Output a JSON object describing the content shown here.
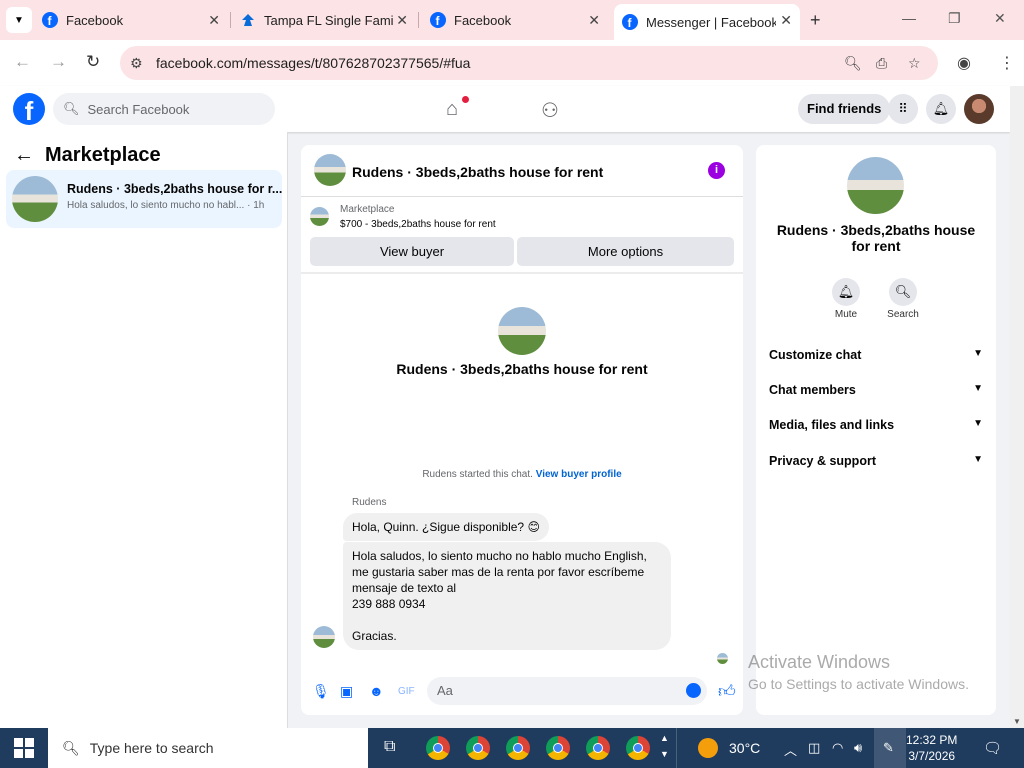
{
  "browser": {
    "tabs": [
      {
        "title": "Facebook",
        "icon": "facebook-icon",
        "active": false
      },
      {
        "title": "Tampa FL Single Family",
        "icon": "zillow-icon",
        "active": false
      },
      {
        "title": "Facebook",
        "icon": "facebook-icon",
        "active": false
      },
      {
        "title": "Messenger | Facebook",
        "icon": "facebook-icon",
        "active": true
      }
    ],
    "new_tab": "+",
    "url": "facebook.com/messages/t/807628702377565/#fua"
  },
  "fb": {
    "logo": "f",
    "search_placeholder": "Search Facebook",
    "find_friends": "Find friends"
  },
  "sidebar": {
    "title": "Marketplace",
    "conversation": {
      "name": "Rudens · 3beds,2baths house for r...",
      "preview": "Hola saludos, lo siento mucho no habl... · 1h"
    }
  },
  "chat": {
    "title": "Rudens · 3beds,2baths house for rent",
    "marketplace_label": "Marketplace",
    "listing": "$700 - 3beds,2baths house for rent",
    "view_buyer": "View buyer",
    "more_options": "More options",
    "intro_title": "Rudens · 3beds,2baths house for rent",
    "started_text": "Rudens started this chat.",
    "buyer_profile_link": "View buyer profile",
    "sender": "Rudens",
    "message1": "Hola, Quinn. ¿Sigue disponible? 😊",
    "message2": "Hola saludos,  lo siento mucho no hablo mucho English,\nme gustaria saber mas de la renta por favor escríbeme\nmensaje de texto al\n239 888 0934\n\nGracias.",
    "composer_placeholder": "Aa"
  },
  "details": {
    "title": "Rudens · 3beds,2baths house for rent",
    "mute": "Mute",
    "search": "Search",
    "items": [
      "Customize chat",
      "Chat members",
      "Media, files and links",
      "Privacy & support"
    ]
  },
  "watermark": {
    "line1": "Activate Windows",
    "line2": "Go to Settings to activate Windows."
  },
  "taskbar": {
    "search_placeholder": "Type here to search",
    "temperature": "30°C",
    "time": "12:32 PM",
    "date": "3/7/2026"
  },
  "colors": {
    "facebook_blue": "#0866ff",
    "tab_strip": "#fbe3e6",
    "taskbar": "#1f3b5d",
    "info_purple": "#9a00e0"
  }
}
